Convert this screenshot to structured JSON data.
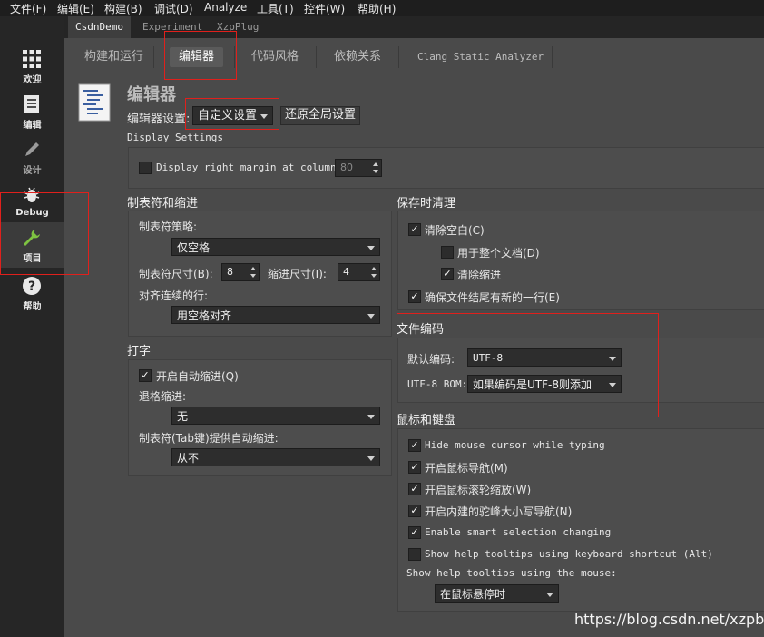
{
  "menubar": [
    "文件(F)",
    "编辑(E)",
    "构建(B)",
    "调试(D)",
    "Analyze",
    "工具(T)",
    "控件(W)",
    "帮助(H)"
  ],
  "modes": [
    {
      "label": "欢迎",
      "icon": "grid-icon"
    },
    {
      "label": "编辑",
      "icon": "document-icon"
    },
    {
      "label": "设计",
      "icon": "pencil-icon"
    },
    {
      "label": "Debug",
      "icon": "bug-icon"
    },
    {
      "label": "项目",
      "icon": "wrench-icon"
    },
    {
      "label": "帮助",
      "icon": "help-icon"
    }
  ],
  "top_tabs": [
    "CsdnDemo",
    "Experiment",
    "XzpPlug"
  ],
  "sub_tabs": [
    "构建和运行",
    "编辑器",
    "代码风格",
    "依赖关系",
    "Clang Static Analyzer"
  ],
  "editor": {
    "title": "编辑器",
    "settings_label": "编辑器设置:",
    "settings_value": "自定义设置",
    "restore_button": "还原全局设置"
  },
  "display": {
    "title": "Display Settings",
    "right_margin_label": "Display right margin at column:",
    "right_margin_value": "80"
  },
  "tabs_indent": {
    "title": "制表符和缩进",
    "policy_label": "制表符策略:",
    "policy_value": "仅空格",
    "tab_size_label": "制表符尺寸(B):",
    "tab_size_value": "8",
    "indent_size_label": "缩进尺寸(I):",
    "indent_size_value": "4",
    "align_label": "对齐连续的行:",
    "align_value": "用空格对齐"
  },
  "typing": {
    "title": "打字",
    "auto_indent": "开启自动缩进(Q)",
    "backspace_label": "退格缩进:",
    "backspace_value": "无",
    "tab_key_label": "制表符(Tab键)提供自动缩进:",
    "tab_key_value": "从不"
  },
  "save_cleanup": {
    "title": "保存时清理",
    "clean_whitespace": "清除空白(C)",
    "whole_document": "用于整个文档(D)",
    "clean_indent": "清除缩进",
    "newline_eof": "确保文件结尾有新的一行(E)"
  },
  "encoding": {
    "title": "文件编码",
    "default_label": "默认编码:",
    "default_value": "UTF-8",
    "bom_label": "UTF-8 BOM:",
    "bom_value": "如果编码是UTF-8则添加"
  },
  "mouse_kb": {
    "title": "鼠标和键盘",
    "hide_cursor": "Hide mouse cursor while typing",
    "mouse_nav": "开启鼠标导航(M)",
    "wheel_zoom": "开启鼠标滚轮缩放(W)",
    "camelcase": "开启内建的驼峰大小写导航(N)",
    "smart_sel": "Enable smart selection changing",
    "tooltips_kb": "Show help tooltips using keyboard shortcut (Alt)",
    "tooltips_mouse_label": "Show help tooltips using the mouse:",
    "tooltips_mouse_value": "在鼠标悬停时"
  },
  "watermark": "https://blog.csdn.net/xzpblog",
  "colors": {
    "highlight_box": "#e0201c",
    "background": "#4a4a4a"
  }
}
